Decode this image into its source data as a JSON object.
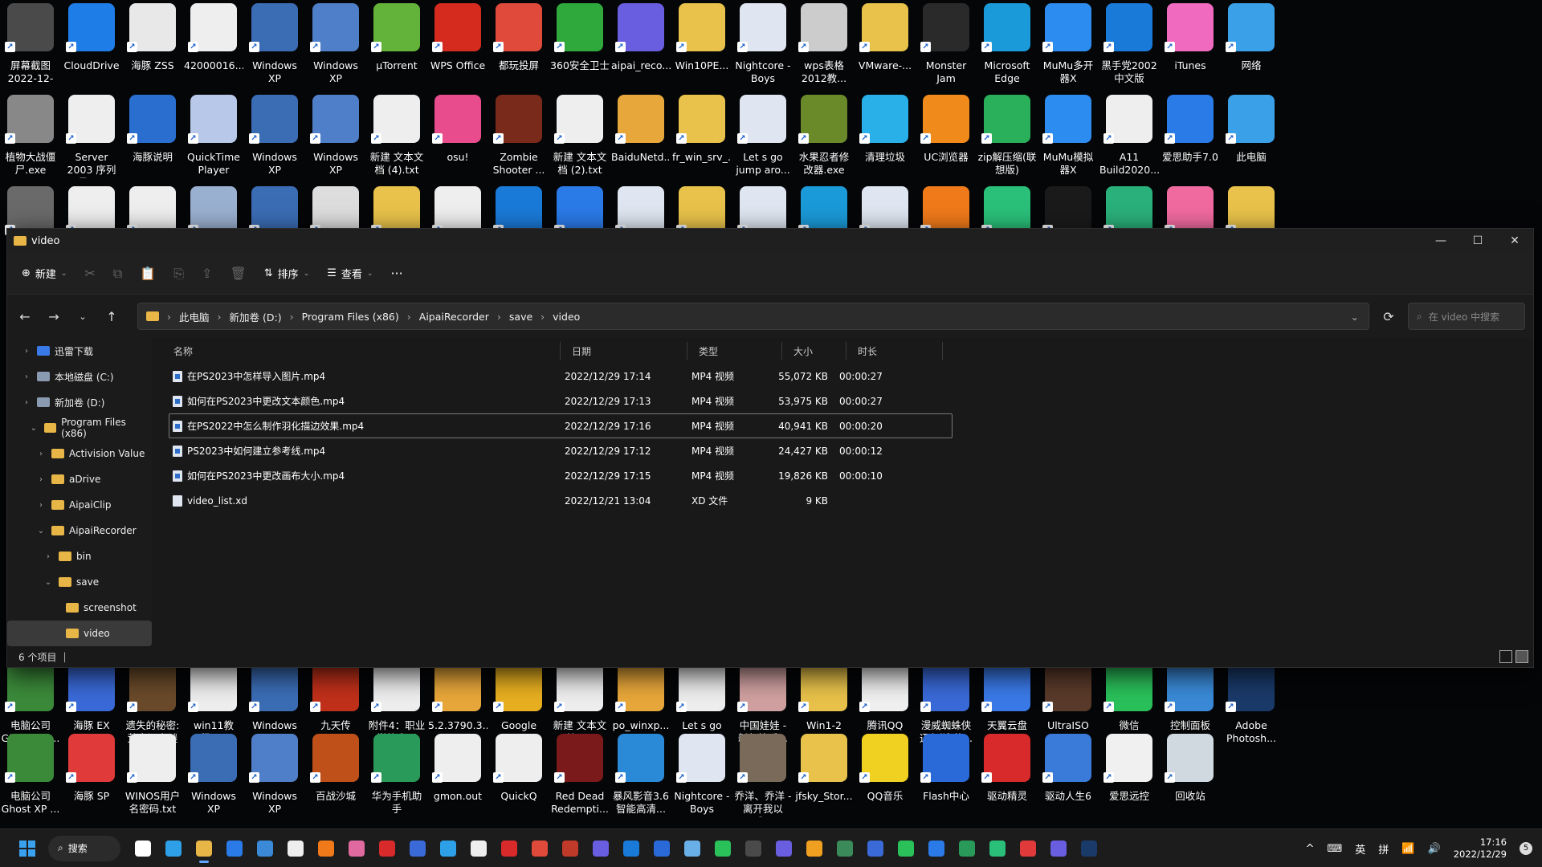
{
  "desktop": {
    "row1": [
      {
        "label": "屏幕截图 2022-12-2...",
        "color": "#4a4a4a",
        "icon": "screenshot-icon"
      },
      {
        "label": "CloudDrive",
        "color": "#1f7de8",
        "icon": "cloud-icon"
      },
      {
        "label": "海豚 ZSS",
        "color": "#e8e8e8",
        "icon": "dolphin-icon"
      },
      {
        "label": "42000016...",
        "color": "#eeeeee",
        "icon": "file-icon"
      },
      {
        "label": "Windows XP Profession...",
        "color": "#3b6db5",
        "icon": "window-icon"
      },
      {
        "label": "Windows XP Profession...",
        "color": "#4f7fc8",
        "icon": "window-icon"
      },
      {
        "label": "µTorrent",
        "color": "#63b33a",
        "icon": "torrent-icon"
      },
      {
        "label": "WPS Office",
        "color": "#d42b1e",
        "icon": "wps-icon"
      },
      {
        "label": "都玩投屏",
        "color": "#e04a3a",
        "icon": "cast-icon"
      },
      {
        "label": "360安全卫士",
        "color": "#2fa83c",
        "icon": "shield-icon"
      },
      {
        "label": "aipai_reco...",
        "color": "#6a5ee0",
        "icon": "recorder-icon"
      },
      {
        "label": "Win10PE...",
        "color": "#e8c24a",
        "icon": "iso-icon"
      },
      {
        "label": "Nightcore - Boys Boys...",
        "color": "#dfe6f1",
        "icon": "bt-icon"
      },
      {
        "label": "wps表格 2012教...",
        "color": "#cccccc",
        "icon": "doc-icon"
      },
      {
        "label": "VMware-...",
        "color": "#e8c24a",
        "icon": "folder-icon"
      },
      {
        "label": "Monster Jam",
        "color": "#2a2a2a",
        "icon": "game-icon"
      },
      {
        "label": "Microsoft Edge",
        "color": "#1a9ad8",
        "icon": "edge-icon"
      },
      {
        "label": "MuMu多开器X",
        "color": "#2d8cf0",
        "icon": "mumu-icon"
      },
      {
        "label": "黑手党2002中文版",
        "color": "#1a7ad8",
        "icon": "game-icon"
      },
      {
        "label": "iTunes",
        "color": "#f06bc0",
        "icon": "music-icon"
      },
      {
        "label": "网络",
        "color": "#3aa0e8",
        "icon": "network-icon"
      }
    ],
    "row2": [
      {
        "label": "植物大战僵尸.exe",
        "color": "#888888",
        "icon": "gear-icon"
      },
      {
        "label": "Server 2003 序列号.txt",
        "color": "#eeeeee",
        "icon": "file-icon"
      },
      {
        "label": "海豚说明",
        "color": "#2a6fd0",
        "icon": "swirl-icon"
      },
      {
        "label": "QuickTime Player",
        "color": "#b8c8e8",
        "icon": "quicktime-icon"
      },
      {
        "label": "Windows XP Profession...",
        "color": "#3b6db5",
        "icon": "window-icon"
      },
      {
        "label": "Windows XP Profession...",
        "color": "#4f7fc8",
        "icon": "window-icon"
      },
      {
        "label": "新建 文本文档 (4).txt",
        "color": "#eeeeee",
        "icon": "file-icon"
      },
      {
        "label": "osu!",
        "color": "#e84c8c",
        "icon": "osu-icon"
      },
      {
        "label": "Zombie Shooter ...",
        "color": "#7a2a1a",
        "icon": "game-icon"
      },
      {
        "label": "新建 文本文档 (2).txt",
        "color": "#eeeeee",
        "icon": "file-icon"
      },
      {
        "label": "BaiduNetd...",
        "color": "#e8a73a",
        "icon": "folder-icon"
      },
      {
        "label": "fr_win_srv_...",
        "color": "#e8c24a",
        "icon": "iso-icon"
      },
      {
        "label": "Let s go jump aro...",
        "color": "#dfe6f1",
        "icon": "wav-icon"
      },
      {
        "label": "水果忍者修改器.exe",
        "color": "#6a8a2a",
        "icon": "game-icon"
      },
      {
        "label": "清理垃圾",
        "color": "#2ab0e8",
        "icon": "trash-icon"
      },
      {
        "label": "UC浏览器",
        "color": "#f08a1a",
        "icon": "uc-icon"
      },
      {
        "label": "zip解压缩(联想版)",
        "color": "#2ab05a",
        "icon": "zip-icon"
      },
      {
        "label": "MuMu模拟器X",
        "color": "#2d8cf0",
        "icon": "mumu-icon"
      },
      {
        "label": "A11 Build2020...",
        "color": "#eeeeee",
        "icon": "user-icon"
      },
      {
        "label": "爱思助手7.0",
        "color": "#2a7ae8",
        "icon": "ifunbox-icon"
      },
      {
        "label": "此电脑",
        "color": "#3aa0e8",
        "icon": "monitor-icon"
      }
    ],
    "row3": [
      {
        "label": "",
        "color": "#6a6a6a",
        "icon": "emblem-icon"
      },
      {
        "label": "",
        "color": "#eeeeee",
        "icon": "file-icon"
      },
      {
        "label": "",
        "color": "#eeeeee",
        "icon": "file-icon"
      },
      {
        "label": "",
        "color": "#9ab0d0",
        "icon": "computer-icon"
      },
      {
        "label": "",
        "color": "#3b6db5",
        "icon": "window-icon"
      },
      {
        "label": "",
        "color": "#dddddd",
        "icon": "window-icon"
      },
      {
        "label": "",
        "color": "#e8c24a",
        "icon": "iso-icon"
      },
      {
        "label": "",
        "color": "#eeeeee",
        "icon": "file-icon"
      },
      {
        "label": "",
        "color": "#1a7ad8",
        "icon": "window-icon"
      },
      {
        "label": "",
        "color": "#2a7ae8",
        "icon": "bird-icon"
      },
      {
        "label": "",
        "color": "#dfe6f1",
        "icon": "window-icon"
      },
      {
        "label": "",
        "color": "#e8c24a",
        "icon": "iso-icon"
      },
      {
        "label": "",
        "color": "#dfe6f1",
        "icon": "wav-icon"
      },
      {
        "label": "",
        "color": "#1a9ad8",
        "icon": "edge-icon"
      },
      {
        "label": "",
        "color": "#dfe6f1",
        "icon": "app-icon"
      },
      {
        "label": "",
        "color": "#f07a1a",
        "icon": "firefox-icon"
      },
      {
        "label": "",
        "color": "#2ac07a",
        "icon": "bag-icon"
      },
      {
        "label": "",
        "color": "#1a1a1a",
        "icon": "app-icon"
      },
      {
        "label": "",
        "color": "#2ab07a",
        "icon": "grid-icon"
      },
      {
        "label": "",
        "color": "#f06aa0",
        "icon": "bilibili-icon"
      },
      {
        "label": "",
        "color": "#e8c24a",
        "icon": "user-folder-icon"
      }
    ],
    "row4": [
      {
        "label": "电脑公司 Ghost XP ...",
        "color": "#3b8a3a",
        "icon": "window-icon"
      },
      {
        "label": "海豚 EX",
        "color": "#3a6ad8",
        "icon": "dolphin-icon"
      },
      {
        "label": "遗失的秘密:荒寨闪之谜",
        "color": "#6a4a2a",
        "icon": "game-icon"
      },
      {
        "label": "win11教程.txt",
        "color": "#eeeeee",
        "icon": "file-icon"
      },
      {
        "label": "Windows XP Profession...",
        "color": "#3b6db5",
        "icon": "window-icon"
      },
      {
        "label": "九天传",
        "color": "#c0301a",
        "icon": "game-icon"
      },
      {
        "label": "附件4：职业学校实习单...",
        "color": "#eeeeee",
        "icon": "doc-icon"
      },
      {
        "label": "5.2.3790.3...",
        "color": "#e8a73a",
        "icon": "archive-icon"
      },
      {
        "label": "Google Chrome",
        "color": "#e8b020",
        "icon": "chrome-icon"
      },
      {
        "label": "新建 文本文档.txt",
        "color": "#eeeeee",
        "icon": "file-icon"
      },
      {
        "label": "po_winxp...",
        "color": "#e8a73a",
        "icon": "archive-icon"
      },
      {
        "label": "Let s go jump arou...",
        "color": "#eeeeee",
        "icon": "doc-icon"
      },
      {
        "label": "中国娃娃 - 新年快乐...",
        "color": "#d0a0a0",
        "icon": "image-icon"
      },
      {
        "label": "Win1-2",
        "color": "#e8c24a",
        "icon": "folder-icon"
      },
      {
        "label": "腾讯QQ",
        "color": "#f0f0f0",
        "icon": "qq-icon"
      },
      {
        "label": "漫威蜘蛛侠迈尔斯 莫...",
        "color": "#3a6ad8",
        "icon": "game-icon"
      },
      {
        "label": "天翼云盘",
        "color": "#3a7ae8",
        "icon": "cloud-icon"
      },
      {
        "label": "UltraISO",
        "color": "#5a3a2a",
        "icon": "disc-icon"
      },
      {
        "label": "微信",
        "color": "#2ac05a",
        "icon": "wechat-icon"
      },
      {
        "label": "控制面板",
        "color": "#3a8ad8",
        "icon": "control-panel-icon"
      },
      {
        "label": "Adobe Photosh...",
        "color": "#1a3a6a",
        "icon": "photoshop-icon"
      }
    ],
    "row5": [
      {
        "label": "电脑公司 Ghost XP ...",
        "color": "#3b8a3a",
        "icon": "window-icon"
      },
      {
        "label": "海豚 SP",
        "color": "#e03a3a",
        "icon": "dolphin-icon"
      },
      {
        "label": "WINOS用户名密码.txt",
        "color": "#eeeeee",
        "icon": "file-icon"
      },
      {
        "label": "Windows XP Profession...",
        "color": "#3b6db5",
        "icon": "window-icon"
      },
      {
        "label": "Windows XP Profession...",
        "color": "#4f7fc8",
        "icon": "window-icon"
      },
      {
        "label": "百战沙城",
        "color": "#c0501a",
        "icon": "game-icon"
      },
      {
        "label": "华为手机助手",
        "color": "#2a9a5a",
        "icon": "huawei-icon"
      },
      {
        "label": "gmon.out",
        "color": "#eeeeee",
        "icon": "file-icon"
      },
      {
        "label": "QuickQ",
        "color": "#eeeeee",
        "icon": "search-icon"
      },
      {
        "label": "Red Dead Redempti...",
        "color": "#7a1a1a",
        "icon": "game-icon"
      },
      {
        "label": "暴风影音3.6智能高清...",
        "color": "#2a8ad8",
        "icon": "archive-icon"
      },
      {
        "label": "Nightcore - Boys Boys...",
        "color": "#dfe6f1",
        "icon": "bt-icon"
      },
      {
        "label": "乔洋、乔洋 - 离开我以后...",
        "color": "#7a6a5a",
        "icon": "image-icon"
      },
      {
        "label": "jfsky_Stor...",
        "color": "#e8c24a",
        "icon": "folder-icon"
      },
      {
        "label": "QQ音乐",
        "color": "#f0d020",
        "icon": "music-icon"
      },
      {
        "label": "Flash中心",
        "color": "#2a6ad8",
        "icon": "flash-icon"
      },
      {
        "label": "驱动精灵",
        "color": "#d82a2a",
        "icon": "driver-icon"
      },
      {
        "label": "驱动人生6",
        "color": "#3a7ad8",
        "icon": "gear-icon"
      },
      {
        "label": "爱思远控",
        "color": "#f0f0f0",
        "icon": "remote-icon"
      },
      {
        "label": "回收站",
        "color": "#d0d8e0",
        "icon": "recycle-bin-icon"
      }
    ]
  },
  "explorer": {
    "title": "video",
    "toolbar": {
      "new_label": "新建",
      "sort_label": "排序",
      "view_label": "查看",
      "more_label": "···"
    },
    "breadcrumb": [
      "此电脑",
      "新加卷 (D:)",
      "Program Files (x86)",
      "AipaiRecorder",
      "save",
      "video"
    ],
    "search_placeholder": "在 video 中搜索",
    "sidebar": [
      {
        "label": "迅雷下载",
        "indent": 1,
        "chev": "›"
      },
      {
        "label": "本地磁盘 (C:)",
        "indent": 1,
        "chev": "›"
      },
      {
        "label": "新加卷 (D:)",
        "indent": 1,
        "chev": "›"
      },
      {
        "label": "Program Files (x86)",
        "indent": 2,
        "chev": "⌄"
      },
      {
        "label": "Activision Value",
        "indent": 3,
        "chev": "›"
      },
      {
        "label": "aDrive",
        "indent": 3,
        "chev": "›"
      },
      {
        "label": "AipaiClip",
        "indent": 3,
        "chev": "›"
      },
      {
        "label": "AipaiRecorder",
        "indent": 3,
        "chev": "⌄"
      },
      {
        "label": "bin",
        "indent": 4,
        "chev": "›"
      },
      {
        "label": "save",
        "indent": 4,
        "chev": "⌄"
      },
      {
        "label": "screenshot",
        "indent": 5,
        "chev": ""
      },
      {
        "label": "video",
        "indent": 5,
        "chev": ""
      }
    ],
    "columns": [
      "名称",
      "日期",
      "类型",
      "大小",
      "时长"
    ],
    "files": [
      {
        "name": "在PS2023中怎样导入图片.mp4",
        "date": "2022/12/29 17:14",
        "type": "MP4 视频",
        "size": "55,072 KB",
        "duration": "00:00:27"
      },
      {
        "name": "如何在PS2023中更改文本颜色.mp4",
        "date": "2022/12/29 17:13",
        "type": "MP4 视频",
        "size": "53,975 KB",
        "duration": "00:00:27"
      },
      {
        "name": "在PS2022中怎么制作羽化描边效果.mp4",
        "date": "2022/12/29 17:16",
        "type": "MP4 视频",
        "size": "40,941 KB",
        "duration": "00:00:20"
      },
      {
        "name": "PS2023中如何建立参考线.mp4",
        "date": "2022/12/29 17:12",
        "type": "MP4 视频",
        "size": "24,427 KB",
        "duration": "00:00:12"
      },
      {
        "name": "如何在PS2023中更改画布大小.mp4",
        "date": "2022/12/29 17:15",
        "type": "MP4 视频",
        "size": "19,826 KB",
        "duration": "00:00:10"
      },
      {
        "name": "video_list.xd",
        "date": "2022/12/21 13:04",
        "type": "XD 文件",
        "size": "9 KB",
        "duration": ""
      }
    ],
    "status": "6 个项目"
  },
  "taskbar": {
    "search_label": "搜索",
    "apps": [
      "#ffffff",
      "#2ea0e8",
      "#e8b547",
      "#2a7ae8",
      "#3a8ad8",
      "#eeeeee",
      "#f07a1a",
      "#e06aa0",
      "#d82a2a",
      "#3a6ad8",
      "#2ea0e8",
      "#eeeeee",
      "#d82a2a",
      "#e04a3a",
      "#c03a2a",
      "#6a5ee0",
      "#1a7ad8",
      "#2a6ad8",
      "#6ab0e8",
      "#2ac05a",
      "#4a4a4a",
      "#6a5ee0",
      "#f0a020",
      "#3a8a5a",
      "#3a6ad8",
      "#2ac05a",
      "#2a7ae8",
      "#2a9a5a",
      "#2ac07a",
      "#e03a3a",
      "#6a5ee0",
      "#1a3a6a"
    ],
    "ime1": "英",
    "ime2": "拼",
    "time": "17:16",
    "date": "2022/12/29",
    "badge": "5"
  }
}
